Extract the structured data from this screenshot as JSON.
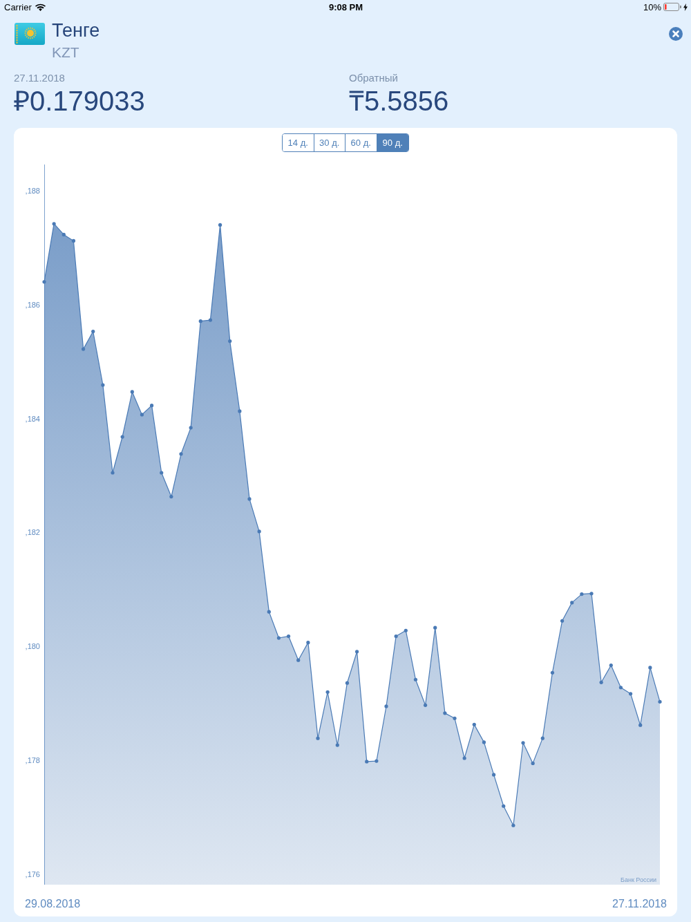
{
  "status_bar": {
    "carrier": "Carrier",
    "time": "9:08 PM",
    "battery": "10%"
  },
  "header": {
    "title": "Тенге",
    "code": "KZT"
  },
  "rates": [
    {
      "label": "27.11.2018",
      "value": "₽0.179033"
    },
    {
      "label": "Обратный",
      "value": "₸5.5856"
    }
  ],
  "chart": {
    "periods": [
      {
        "label": "14 д.",
        "selected": false
      },
      {
        "label": "30 д.",
        "selected": false
      },
      {
        "label": "60 д.",
        "selected": false
      },
      {
        "label": "90 д.",
        "selected": true
      }
    ],
    "source": "Банк России",
    "start_date": "29.08.2018",
    "end_date": "27.11.2018",
    "chart_data": {
      "type": "area",
      "categories": [
        null,
        null,
        null,
        null,
        null,
        null,
        null,
        null,
        null,
        null,
        null,
        null,
        null,
        null,
        null,
        null,
        null,
        null,
        null,
        null,
        null,
        null,
        null,
        null,
        null,
        null,
        null,
        null,
        null,
        null,
        null,
        null,
        null,
        null,
        null,
        null,
        null,
        null,
        null,
        null,
        null,
        null,
        null,
        null,
        null,
        null,
        null,
        null,
        null,
        null,
        null,
        null,
        null,
        null,
        null,
        null,
        null,
        null,
        null,
        null,
        null,
        null,
        null,
        null
      ],
      "series": [
        {
          "color": "#4a7ab5",
          "values": [
            186.4,
            187.42,
            187.23,
            187.12,
            185.22,
            185.53,
            184.59,
            183.05,
            183.68,
            184.47,
            184.07,
            184.23,
            183.05,
            182.63,
            183.38,
            183.84,
            185.71,
            185.73,
            187.4,
            185.36,
            184.13,
            182.59,
            182.02,
            180.61,
            180.15,
            180.18,
            179.76,
            180.07,
            178.39,
            179.2,
            178.27,
            179.36,
            179.91,
            177.98,
            177.99,
            178.95,
            180.18,
            180.28,
            179.42,
            178.97,
            180.33,
            178.83,
            178.74,
            178.04,
            178.63,
            178.32,
            177.75,
            177.2,
            176.86,
            178.31,
            177.95,
            178.39,
            179.54,
            180.45,
            180.77,
            180.92,
            180.93,
            179.37,
            179.67,
            179.28,
            179.17,
            178.62,
            179.63,
            179.03
          ]
        }
      ],
      "ylim": [
        175.82,
        188.46
      ],
      "yticks": [
        {
          "value": 176,
          "label": ",176"
        },
        {
          "value": 178,
          "label": ",178"
        },
        {
          "value": 180,
          "label": ",180"
        },
        {
          "value": 182,
          "label": ",182"
        },
        {
          "value": 184,
          "label": ",184"
        },
        {
          "value": 186,
          "label": ",186"
        },
        {
          "value": 188,
          "label": ",188"
        }
      ]
    }
  }
}
